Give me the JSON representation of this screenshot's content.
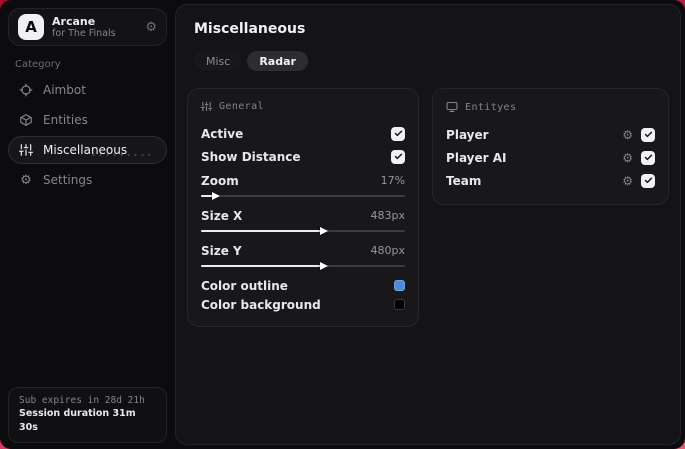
{
  "theme": {
    "backdrop_top": "#a30f31",
    "backdrop_bottom": "#ee567a",
    "accent_checkbox": "#f2f2f4"
  },
  "sidebar": {
    "brand": {
      "initial": "A",
      "title": "Arcane",
      "subtitle": "for The Finals",
      "action_icon": "gear-icon",
      "gear_glyph": "⚙"
    },
    "category_label": "Category",
    "items": [
      {
        "label": "Aimbot",
        "icon": "crosshair-icon",
        "selected": false
      },
      {
        "label": "Entities",
        "icon": "cube-icon",
        "selected": false
      },
      {
        "label": "Miscellaneous",
        "icon": "sliders-icon",
        "selected": true
      },
      {
        "label": "Settings",
        "icon": "gear-icon",
        "selected": false
      }
    ],
    "footer": {
      "line1": "Sub expires in 28d 21h",
      "line2": "Session duration 31m 30s"
    }
  },
  "main": {
    "title": "Miscellaneous",
    "tabs": [
      {
        "label": "Misc",
        "selected": false
      },
      {
        "label": "Radar",
        "selected": true
      }
    ],
    "general": {
      "title": "General",
      "icon": "sliders-icon",
      "toggles": [
        {
          "label": "Active",
          "checked": true
        },
        {
          "label": "Show Distance",
          "checked": true
        }
      ],
      "sliders": [
        {
          "label": "Zoom",
          "value": "17%",
          "percent": 6
        },
        {
          "label": "Size X",
          "value": "483px",
          "percent": 59
        },
        {
          "label": "Size Y",
          "value": "480px",
          "percent": 59
        }
      ],
      "colors": [
        {
          "label": "Color outline",
          "color": "#4d8ad9"
        },
        {
          "label": "Color background",
          "color": "#000000"
        }
      ]
    },
    "entities": {
      "title": "Entityes",
      "icon": "monitor-icon",
      "gear_glyph": "⚙",
      "rows": [
        {
          "label": "Player",
          "checked": true
        },
        {
          "label": "Player AI",
          "checked": true
        },
        {
          "label": "Team",
          "checked": true
        }
      ]
    }
  }
}
